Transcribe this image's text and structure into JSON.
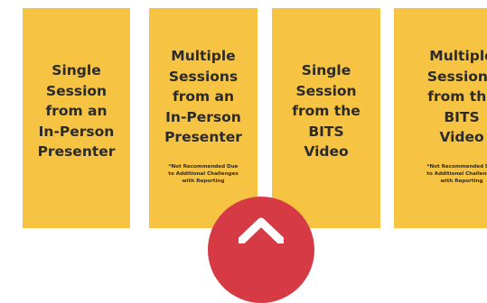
{
  "cards": [
    {
      "title": "Single\nSession\nfrom an\nIn-Person\nPresenter",
      "note": ""
    },
    {
      "title": "Multiple\nSessions\nfrom an\nIn-Person\nPresenter",
      "note": "*Not Recommended Due\nto Additional Challenges\nwith Reporting"
    },
    {
      "title": "Single\nSession\nfrom the\nBITS\nVideo",
      "note": ""
    },
    {
      "title": "Multiple\nSessions\nfrom the\nBITS\nVideo",
      "note": "*Not Recommended Due\nto Additional Challenges\nwith Reporting"
    }
  ],
  "colors": {
    "card": "#f6c343",
    "text": "#2b2b2b",
    "badge": "#d63b45"
  },
  "icons": {
    "badge_icon": "chevron-up-icon"
  }
}
